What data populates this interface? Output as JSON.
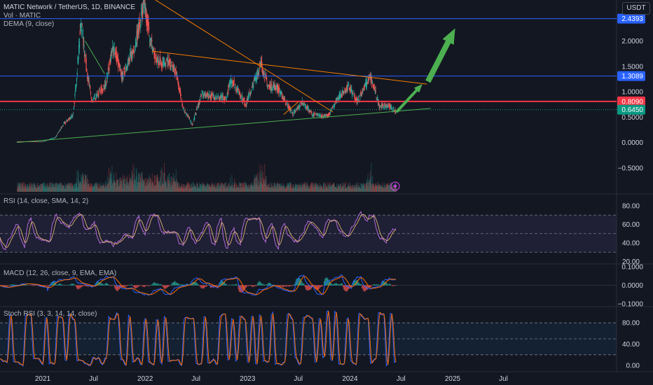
{
  "header": {
    "title": "MATIC Network / TetherUS, 1D, BINANCE",
    "vol_label": "Vol · MATIC",
    "dema_label": "DEMA (9, close)",
    "currency": "USDT"
  },
  "price_axis": {
    "ticks": [
      "2.0000",
      "1.5000",
      "1.0000",
      "0.5000",
      "0.0000",
      "−0.5000"
    ],
    "badges": [
      {
        "text": "2.4393",
        "color": "#2962ff"
      },
      {
        "text": "1.3089",
        "color": "#2962ff"
      },
      {
        "text": "0.8090",
        "color": "#f23645"
      },
      {
        "text": "0.6450",
        "color": "#089981"
      }
    ]
  },
  "time_axis": [
    "2021",
    "Jul",
    "2022",
    "Jul",
    "2023",
    "Jul",
    "2024",
    "Jul",
    "2025",
    "Jul"
  ],
  "rsi": {
    "label": "RSI (14, close, SMA, 14, 2)",
    "ticks": [
      "80.00",
      "60.00",
      "40.00",
      "20.00"
    ]
  },
  "macd": {
    "label": "MACD (12, 26, close, 9, EMA, EMA)",
    "ticks": [
      "0.1000",
      "0.0000",
      "−0.1000"
    ]
  },
  "stoch": {
    "label": "Stoch RSI (3, 3, 14, 14, close)",
    "ticks": [
      "80.00",
      "40.00",
      "0.00"
    ]
  },
  "colors": {
    "background": "#131722",
    "up": "#26a69a",
    "down": "#ef5350",
    "blue_line": "#2962ff",
    "red_line": "#f23645",
    "orange_trend": "#f57c00",
    "green_trend": "#4caf50",
    "rsi": "#b36ad6",
    "stoch_k": "#2962ff",
    "stoch_d": "#ff6d00",
    "macd": "#2962ff",
    "signal": "#ff6d00",
    "arrow": "#4caf50"
  },
  "chart_data": {
    "type": "candlestick",
    "symbol": "MATICUSDT",
    "timeframe": "1D",
    "x_range": [
      "2020-10",
      "2025-09"
    ],
    "price_range": [
      -0.65,
      2.55
    ],
    "price_series": [
      {
        "date": "2020-10-01",
        "close": 0.02
      },
      {
        "date": "2021-01-01",
        "close": 0.02
      },
      {
        "date": "2021-02-15",
        "close": 0.1
      },
      {
        "date": "2021-03-15",
        "close": 0.35
      },
      {
        "date": "2021-04-20",
        "close": 0.55
      },
      {
        "date": "2021-05-18",
        "close": 2.4
      },
      {
        "date": "2021-06-05",
        "close": 1.5
      },
      {
        "date": "2021-06-25",
        "close": 0.8
      },
      {
        "date": "2021-08-10",
        "close": 1.1
      },
      {
        "date": "2021-09-10",
        "close": 1.9
      },
      {
        "date": "2021-10-10",
        "close": 1.3
      },
      {
        "date": "2021-11-20",
        "close": 1.8
      },
      {
        "date": "2021-12-27",
        "close": 2.7
      },
      {
        "date": "2022-01-20",
        "close": 2.0
      },
      {
        "date": "2022-02-10",
        "close": 1.6
      },
      {
        "date": "2022-03-20",
        "close": 1.6
      },
      {
        "date": "2022-04-20",
        "close": 1.4
      },
      {
        "date": "2022-05-15",
        "close": 0.7
      },
      {
        "date": "2022-06-18",
        "close": 0.35
      },
      {
        "date": "2022-07-20",
        "close": 0.95
      },
      {
        "date": "2022-09-10",
        "close": 0.9
      },
      {
        "date": "2022-10-15",
        "close": 0.85
      },
      {
        "date": "2022-11-05",
        "close": 1.25
      },
      {
        "date": "2022-12-25",
        "close": 0.75
      },
      {
        "date": "2023-02-18",
        "close": 1.55
      },
      {
        "date": "2023-03-15",
        "close": 1.1
      },
      {
        "date": "2023-04-15",
        "close": 1.1
      },
      {
        "date": "2023-06-12",
        "close": 0.55
      },
      {
        "date": "2023-07-15",
        "close": 0.8
      },
      {
        "date": "2023-08-20",
        "close": 0.55
      },
      {
        "date": "2023-10-15",
        "close": 0.52
      },
      {
        "date": "2023-11-15",
        "close": 0.85
      },
      {
        "date": "2023-12-28",
        "close": 1.1
      },
      {
        "date": "2024-01-25",
        "close": 0.8
      },
      {
        "date": "2024-03-13",
        "close": 1.3
      },
      {
        "date": "2024-04-15",
        "close": 0.72
      },
      {
        "date": "2024-05-20",
        "close": 0.72
      },
      {
        "date": "2024-06-14",
        "close": 0.6
      }
    ],
    "horizontal_levels": [
      {
        "price": 2.4393,
        "color": "#2962ff"
      },
      {
        "price": 1.3089,
        "color": "#2962ff"
      },
      {
        "price": 0.809,
        "color": "#f23645"
      },
      {
        "price": 0.645,
        "color": "#089981"
      }
    ],
    "trendlines": [
      {
        "color": "#f57c00",
        "points": [
          [
            "2021-12-28",
            2.95
          ],
          [
            "2023-11-01",
            0.6
          ]
        ]
      },
      {
        "color": "#f57c00",
        "points": [
          [
            "2022-01-25",
            1.8
          ],
          [
            "2024-10-01",
            1.15
          ]
        ]
      },
      {
        "color": "#f57c00",
        "points": [
          [
            "2023-05-10",
            0.55
          ],
          [
            "2023-07-01",
            0.8
          ]
        ]
      },
      {
        "color": "#4caf50",
        "points": [
          [
            "2020-10-01",
            0.0
          ],
          [
            "2024-10-15",
            0.67
          ]
        ]
      },
      {
        "color": "#4caf50",
        "points": [
          [
            "2021-06-01",
            2.0
          ],
          [
            "2021-08-10",
            1.35
          ]
        ]
      }
    ],
    "projection_arrows": [
      {
        "from": [
          "2024-06-15",
          0.6
        ],
        "to": [
          "2024-09-15",
          1.15
        ]
      },
      {
        "from": [
          "2024-10-05",
          1.2
        ],
        "to": [
          "2025-01-10",
          2.25
        ]
      }
    ],
    "indicators": {
      "rsi": {
        "params": [
          14,
          "close",
          "SMA",
          14,
          2
        ],
        "bands": [
          70,
          50,
          30
        ],
        "range": [
          20,
          85
        ]
      },
      "macd": {
        "params": [
          12,
          26,
          "close",
          9,
          "EMA",
          "EMA"
        ],
        "range": [
          -0.1,
          0.1
        ]
      },
      "stoch_rsi": {
        "params": [
          3,
          3,
          14,
          14,
          "close"
        ],
        "bands": [
          80,
          50,
          20
        ],
        "range": [
          0,
          100
        ]
      }
    }
  }
}
